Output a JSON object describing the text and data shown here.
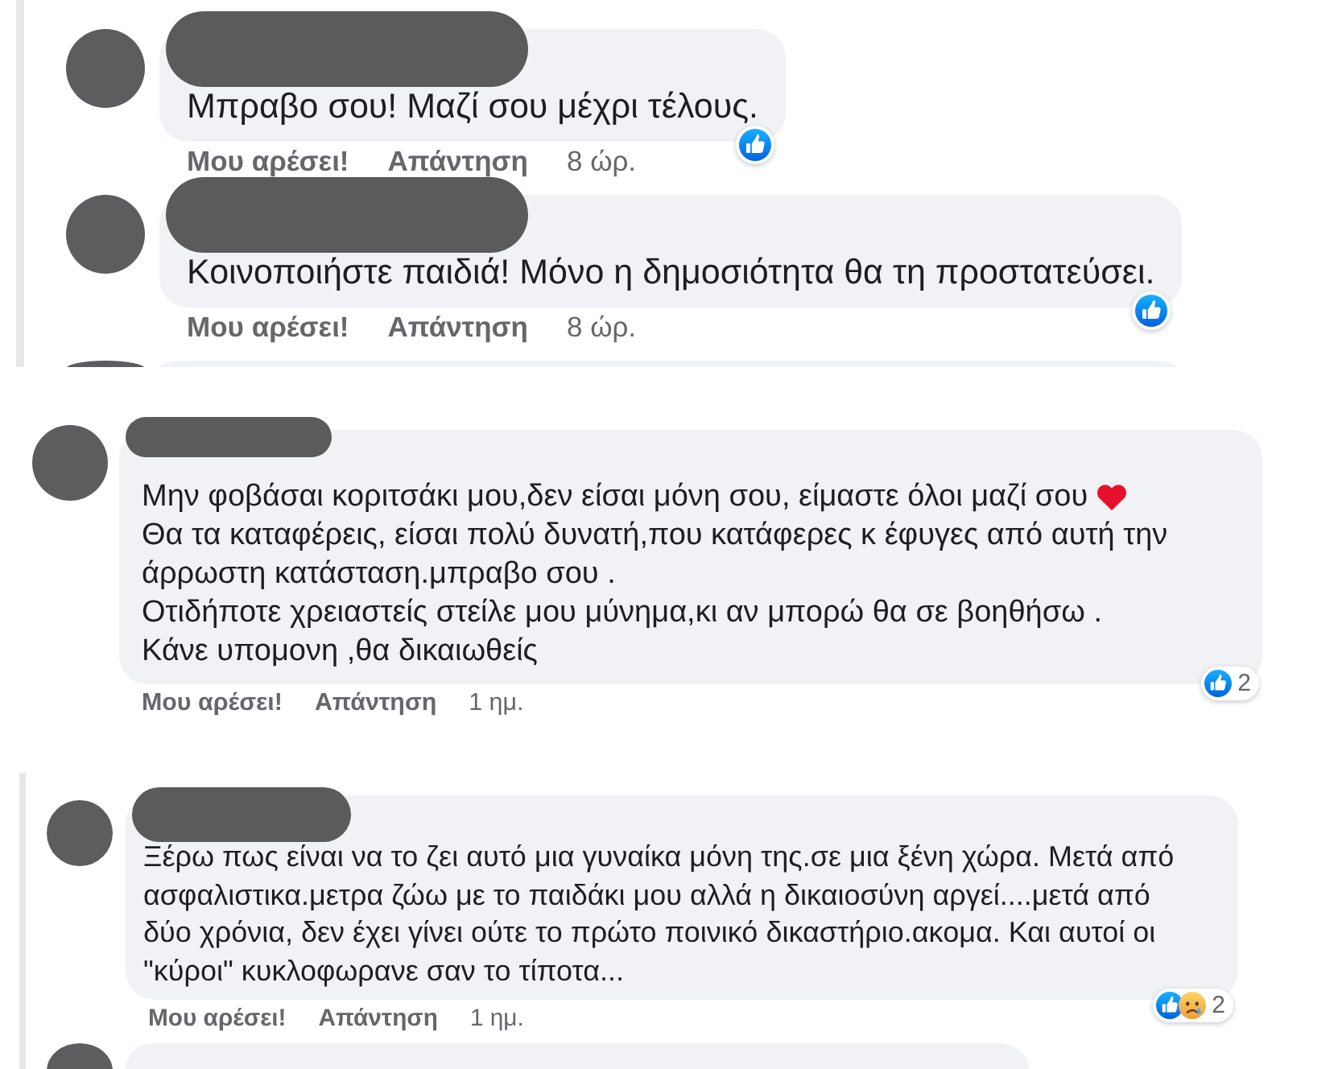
{
  "panels": [
    {
      "comments": [
        {
          "lines": [
            {
              "text": "Μπραβο σου! Μαζί σου μέχρι τέλους."
            }
          ],
          "reactions": [
            {
              "kind": "like"
            }
          ],
          "actions": [
            {
              "kind": "like",
              "label": "Μου αρέσει!"
            },
            {
              "kind": "reply",
              "label": "Απάντηση"
            },
            {
              "kind": "time",
              "label": "8 ώρ."
            }
          ]
        },
        {
          "lines": [
            {
              "text": "Κοινοποιήστε παιδιά! Μόνο η δημοσιότητα θα τη προστατεύσει."
            }
          ],
          "reactions": [
            {
              "kind": "like"
            }
          ],
          "actions": [
            {
              "kind": "like",
              "label": "Μου αρέσει!"
            },
            {
              "kind": "reply",
              "label": "Απάντηση"
            },
            {
              "kind": "time",
              "label": "8 ώρ."
            }
          ]
        }
      ],
      "more_below": true
    },
    {
      "comments": [
        {
          "lines": [
            {
              "text": "Μην φοβάσαι κοριτσάκι μου,δεν είσαι μόνη σου, είμαστε όλοι μαζί σου",
              "heart": true
            },
            {
              "text": "Θα τα καταφέρεις, είσαι πολύ δυνατή,που κατάφερες κ έφυγες από αυτή την"
            },
            {
              "text": "άρρωστη κατάσταση.μπραβο σου ."
            },
            {
              "text": "Οτιδήποτε χρειαστείς στείλε μου μύνημα,κι αν μπορώ θα σε βοηθήσω ."
            },
            {
              "text": "Κάνε υπομονη ,θα δικαιωθείς"
            }
          ],
          "reactions": [
            {
              "kind": "like"
            }
          ],
          "reaction_count": "2",
          "actions": [
            {
              "kind": "like",
              "label": "Μου αρέσει!"
            },
            {
              "kind": "reply",
              "label": "Απάντηση"
            },
            {
              "kind": "time",
              "label": "1 ημ."
            }
          ]
        }
      ]
    },
    {
      "comments": [
        {
          "lines": [
            {
              "text": "Ξέρω πως είναι να το ζει αυτό μια γυναίκα μόνη της.σε μια ξένη χώρα. Μετά από"
            },
            {
              "text": "ασφαλιστικα.μετρα ζώω με το παιδάκι μου αλλά η δικαιοσύνη αργεί....μετά από"
            },
            {
              "text": "δύο χρόνια, δεν έχει γίνει ούτε το πρώτο ποινικό δικαστήριο.ακομα. Και αυτοί οι"
            },
            {
              "text": "\"κύροι\" κυκλοφωρανε σαν το τίποτα..."
            }
          ],
          "reactions": [
            {
              "kind": "like"
            },
            {
              "kind": "sad"
            }
          ],
          "reaction_count": "2",
          "actions": [
            {
              "kind": "like",
              "label": "Μου αρέσει!"
            },
            {
              "kind": "reply",
              "label": "Απάντηση"
            },
            {
              "kind": "time",
              "label": "1 ημ."
            }
          ]
        }
      ],
      "more_below": true
    }
  ]
}
